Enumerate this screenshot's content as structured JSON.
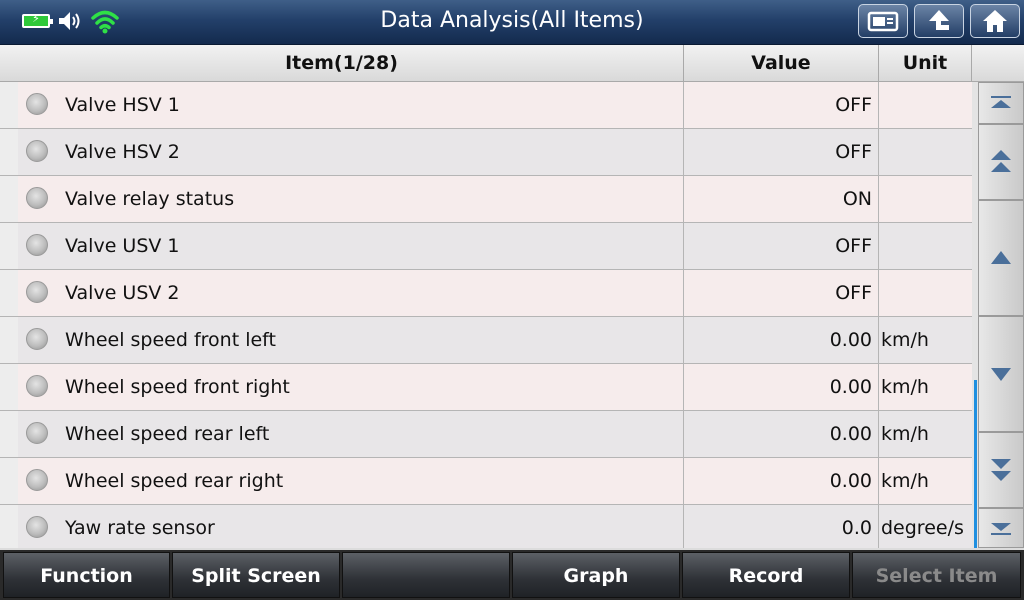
{
  "header": {
    "title": "Data Analysis(All Items)",
    "icons": [
      "battery-icon",
      "speaker-icon",
      "wifi-icon"
    ],
    "buttons": [
      "screenshot-icon",
      "back-icon",
      "home-icon"
    ]
  },
  "table": {
    "columns": {
      "item": "Item(1/28)",
      "value": "Value",
      "unit": "Unit"
    },
    "rows": [
      {
        "name": "Valve HSV 1",
        "value": "OFF",
        "unit": ""
      },
      {
        "name": "Valve HSV 2",
        "value": "OFF",
        "unit": ""
      },
      {
        "name": "Valve relay status",
        "value": "ON",
        "unit": ""
      },
      {
        "name": "Valve USV 1",
        "value": "OFF",
        "unit": ""
      },
      {
        "name": "Valve USV 2",
        "value": "OFF",
        "unit": ""
      },
      {
        "name": "Wheel speed front left",
        "value": "0.00",
        "unit": "km/h"
      },
      {
        "name": "Wheel speed front right",
        "value": "0.00",
        "unit": "km/h"
      },
      {
        "name": "Wheel speed rear left",
        "value": "0.00",
        "unit": "km/h"
      },
      {
        "name": "Wheel speed rear right",
        "value": "0.00",
        "unit": "km/h"
      },
      {
        "name": "Yaw rate sensor",
        "value": "0.0",
        "unit": "degree/s"
      }
    ]
  },
  "scroll": {
    "buttons": [
      "scroll-top-icon",
      "page-up-icon",
      "line-up-icon",
      "line-down-icon",
      "page-down-icon",
      "scroll-bottom-icon"
    ],
    "thumb_start_fraction": 0.64,
    "thumb_end_fraction": 1.0
  },
  "footer": {
    "buttons": [
      {
        "label": "Function",
        "enabled": true
      },
      {
        "label": "Split Screen",
        "enabled": true
      },
      {
        "label": "",
        "enabled": true
      },
      {
        "label": "Graph",
        "enabled": true
      },
      {
        "label": "Record",
        "enabled": true
      },
      {
        "label": "Select Item",
        "enabled": false
      }
    ]
  },
  "colors": {
    "title_bar": "#23406a",
    "wifi": "#2fe046",
    "battery": "#2fc93a",
    "scroll_thumb": "#1e8fe0"
  }
}
